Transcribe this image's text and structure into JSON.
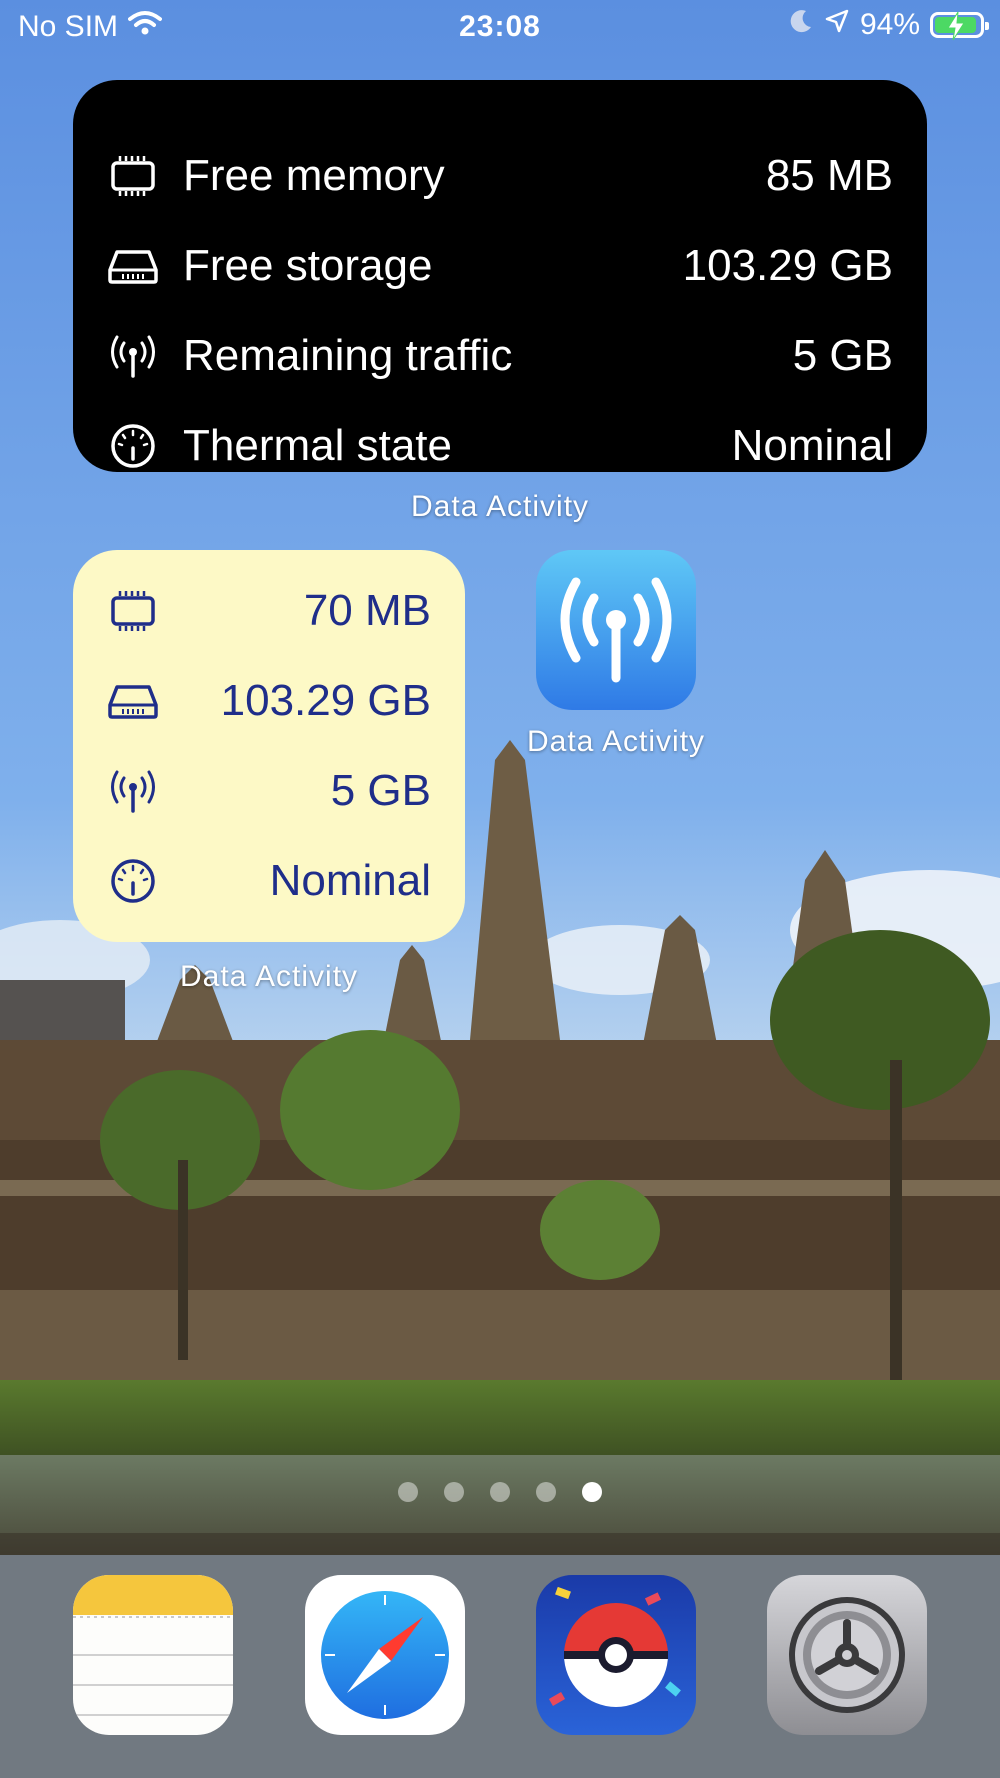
{
  "status_bar": {
    "carrier": "No SIM",
    "time": "23:08",
    "battery_percent": "94%",
    "battery_level": 0.94,
    "wifi_icon": "wifi-icon",
    "moon_icon": "moon-icon",
    "location_icon": "location-arrow-icon",
    "battery_color": "#4cd964"
  },
  "large_widget": {
    "rows": [
      {
        "icon": "memory-chip-icon",
        "label": "Free memory",
        "value": "85 MB"
      },
      {
        "icon": "storage-drive-icon",
        "label": "Free storage",
        "value": "103.29 GB"
      },
      {
        "icon": "antenna-signal-icon",
        "label": "Remaining traffic",
        "value": "5 GB"
      },
      {
        "icon": "thermometer-gauge-icon",
        "label": "Thermal state",
        "value": "Nominal"
      }
    ],
    "background": "#000000",
    "caption": "Data Activity"
  },
  "small_widget": {
    "rows": [
      {
        "icon": "memory-chip-icon",
        "value": "70 MB"
      },
      {
        "icon": "storage-drive-icon",
        "value": "103.29 GB"
      },
      {
        "icon": "antenna-signal-icon",
        "value": "5 GB"
      },
      {
        "icon": "thermometer-gauge-icon",
        "value": "Nominal"
      }
    ],
    "background": "#fdf9c6",
    "text_color": "#1f2e8a",
    "caption": "Data Activity"
  },
  "app_icon": {
    "label": "Data Activity",
    "icon": "antenna-signal-icon"
  },
  "page_dots": {
    "count": 5,
    "active_index": 4
  },
  "dock": {
    "apps": [
      {
        "name": "notes-app-icon"
      },
      {
        "name": "safari-app-icon"
      },
      {
        "name": "pokemon-go-app-icon"
      },
      {
        "name": "settings-app-icon"
      }
    ]
  }
}
